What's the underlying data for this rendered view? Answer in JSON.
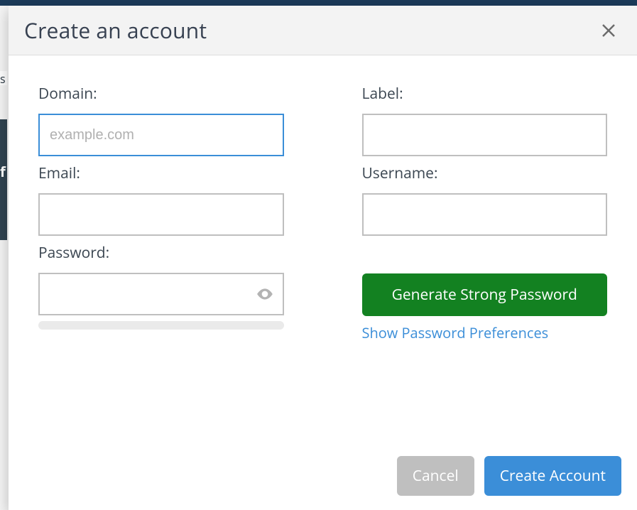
{
  "modal": {
    "title": "Create an account",
    "close_label": "Close"
  },
  "form": {
    "domain": {
      "label": "Domain:",
      "placeholder": "example.com",
      "value": ""
    },
    "label_field": {
      "label": "Label:",
      "placeholder": "",
      "value": ""
    },
    "email": {
      "label": "Email:",
      "placeholder": "",
      "value": ""
    },
    "username": {
      "label": "Username:",
      "placeholder": "",
      "value": ""
    },
    "password": {
      "label": "Password:",
      "placeholder": "",
      "value": ""
    }
  },
  "buttons": {
    "generate": "Generate Strong Password",
    "show_prefs": "Show Password Preferences",
    "cancel": "Cancel",
    "create": "Create Account"
  },
  "background": {
    "s_text": "s",
    "f_text": "f"
  }
}
